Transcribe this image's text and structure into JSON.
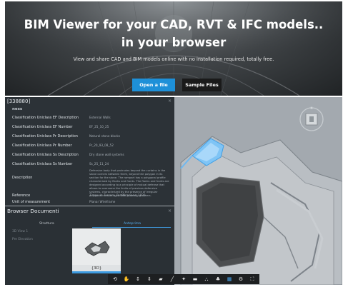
{
  "hero": {
    "title_line1": "BIM Viewer for your CAD, RVT & IFC models..",
    "title_line2": "in your browser",
    "subtitle": "View and share CAD and BIM models online with no installation required, totally free.",
    "open_button": "Open a file",
    "samples_button": "Sample Files"
  },
  "properties": {
    "title": "[338880]",
    "close_icon": "×",
    "group": "ness",
    "rows": [
      {
        "label": "Classification Uniclass EF Description",
        "value": "External Walls"
      },
      {
        "label": "Classification Uniclass EF Number",
        "value": "EF_25_10_25"
      },
      {
        "label": "Classification Uniclass Pr Description",
        "value": "Natural stone blocks"
      },
      {
        "label": "Classification Uniclass Pr Number",
        "value": "Pr_20_93_08_52"
      },
      {
        "label": "Classification Uniclass Ss Description",
        "value": "Dry stone wall systems"
      },
      {
        "label": "Classification Uniclass Ss Number",
        "value": "Ss_25_11_24"
      },
      {
        "label": "Description",
        "value": "Defensive body that protrudes beyond the curtains in the stone corners between them, beyond the polygon in its section for the stone. The rampart has a polygonal profile characterized by flanks and fronts. The flanks and fronts are designed according to a principle of mutual defense that allows to overcome the limits of previous defensive systems, characterized by the presence of irregular polygonal curtain walls with protruding towers."
      },
      {
        "label": "Reference",
        "value": "Tirrenum Tessere_Fortificazione_1820"
      },
      {
        "label": "Unit of measurement",
        "value": "Planar Wireframe"
      }
    ]
  },
  "documents": {
    "title": "Browser Documenti",
    "close_icon": "×",
    "tab_structure": "Struttura",
    "tab_active": "Anteprima",
    "rows": [
      "3D View 1",
      "Pre Elevation"
    ],
    "thumbnail_label": "{3D}"
  },
  "toolbar": {
    "icons": [
      {
        "name": "orbit-icon",
        "glyph": "⟲"
      },
      {
        "name": "pan-icon",
        "glyph": "✋"
      },
      {
        "name": "zoom-icon",
        "glyph": "↕"
      },
      {
        "name": "fit-view-icon",
        "glyph": "⇕"
      },
      {
        "name": "camera-icon",
        "glyph": "▰"
      },
      {
        "name": "measure-icon",
        "glyph": "╱"
      },
      {
        "name": "section-icon",
        "glyph": "✦"
      },
      {
        "name": "explode-icon",
        "glyph": "▬"
      },
      {
        "name": "model-browser-icon",
        "glyph": "⛬"
      },
      {
        "name": "structure-icon",
        "glyph": "♣"
      },
      {
        "name": "document-browser-icon",
        "glyph": "▦"
      },
      {
        "name": "settings-icon",
        "glyph": "⚙"
      },
      {
        "name": "fullscreen-icon",
        "glyph": "⛶"
      }
    ],
    "active_index": 10
  },
  "colors": {
    "accent": "#1e90d8",
    "panel": "#2c3237",
    "selection": "#7fc4f5"
  }
}
